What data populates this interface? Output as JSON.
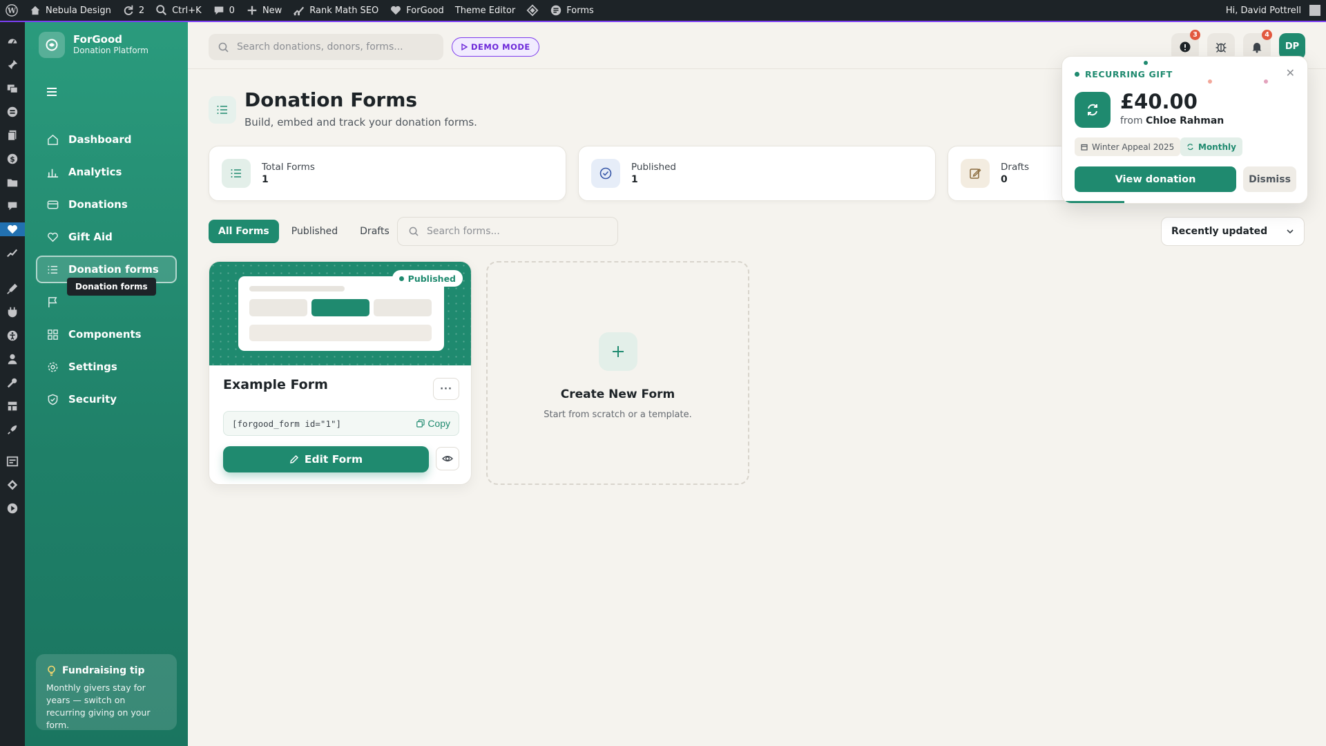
{
  "adminbar": {
    "site_name": "Nebula Design",
    "updates_count": "2",
    "search_shortcut": "Ctrl+K",
    "comments_count": "0",
    "new_label": "New",
    "seo_label": "Rank Math SEO",
    "forgood_label": "ForGood",
    "theme_editor_label": "Theme Editor",
    "forms_label": "Forms",
    "greeting": "Hi, David Pottrell"
  },
  "brand": {
    "name": "ForGood",
    "subtitle": "Donation Platform"
  },
  "nav": [
    {
      "label": "Dashboard",
      "icon": "home-icon"
    },
    {
      "label": "Analytics",
      "icon": "bar-chart-icon"
    },
    {
      "label": "Donations",
      "icon": "card-icon"
    },
    {
      "label": "Gift Aid",
      "icon": "heart-icon"
    },
    {
      "label": "Donation forms",
      "icon": "list-icon",
      "active": true
    },
    {
      "label": "",
      "icon": "flag-icon"
    },
    {
      "label": "Components",
      "icon": "grid-icon"
    },
    {
      "label": "Settings",
      "icon": "gear-icon"
    },
    {
      "label": "Security",
      "icon": "shield-icon"
    }
  ],
  "tooltip": "Donation forms",
  "tip": {
    "title": "Fundraising tip",
    "body": "Monthly givers stay for years — switch on recurring giving on your form."
  },
  "header": {
    "search_placeholder": "Search donations, donors, forms...",
    "demo_label": "DEMO MODE",
    "alerts_badge": "3",
    "notifications_badge": "4",
    "avatar_initials": "DP"
  },
  "page": {
    "title": "Donation Forms",
    "subtitle": "Build, embed and track your donation forms."
  },
  "stats": [
    {
      "label": "Total Forms",
      "value": "1"
    },
    {
      "label": "Published",
      "value": "1"
    },
    {
      "label": "Drafts",
      "value": "0"
    }
  ],
  "filters": {
    "tabs": [
      "All Forms",
      "Published",
      "Drafts"
    ],
    "active_tab": "All Forms",
    "search_placeholder": "Search forms...",
    "sort_value": "Recently updated"
  },
  "form_card": {
    "status": "Published",
    "title": "Example Form",
    "shortcode": "[forgood_form id=\"1\"]",
    "copy_label": "Copy",
    "edit_label": "Edit Form"
  },
  "create_card": {
    "title": "Create New Form",
    "subtitle": "Start from scratch or a template."
  },
  "popup": {
    "heading": "RECURRING GIFT",
    "amount": "£40.00",
    "from_prefix": "from",
    "donor": "Chloe Rahman",
    "campaign": "Winter Appeal 2025",
    "frequency": "Monthly",
    "view_label": "View donation",
    "dismiss_label": "Dismiss"
  },
  "colors": {
    "brand": "#1f8a6f",
    "sidebar_top": "#2a9b7d",
    "accent_purple": "#7c3aed",
    "badge": "#e2583e"
  }
}
